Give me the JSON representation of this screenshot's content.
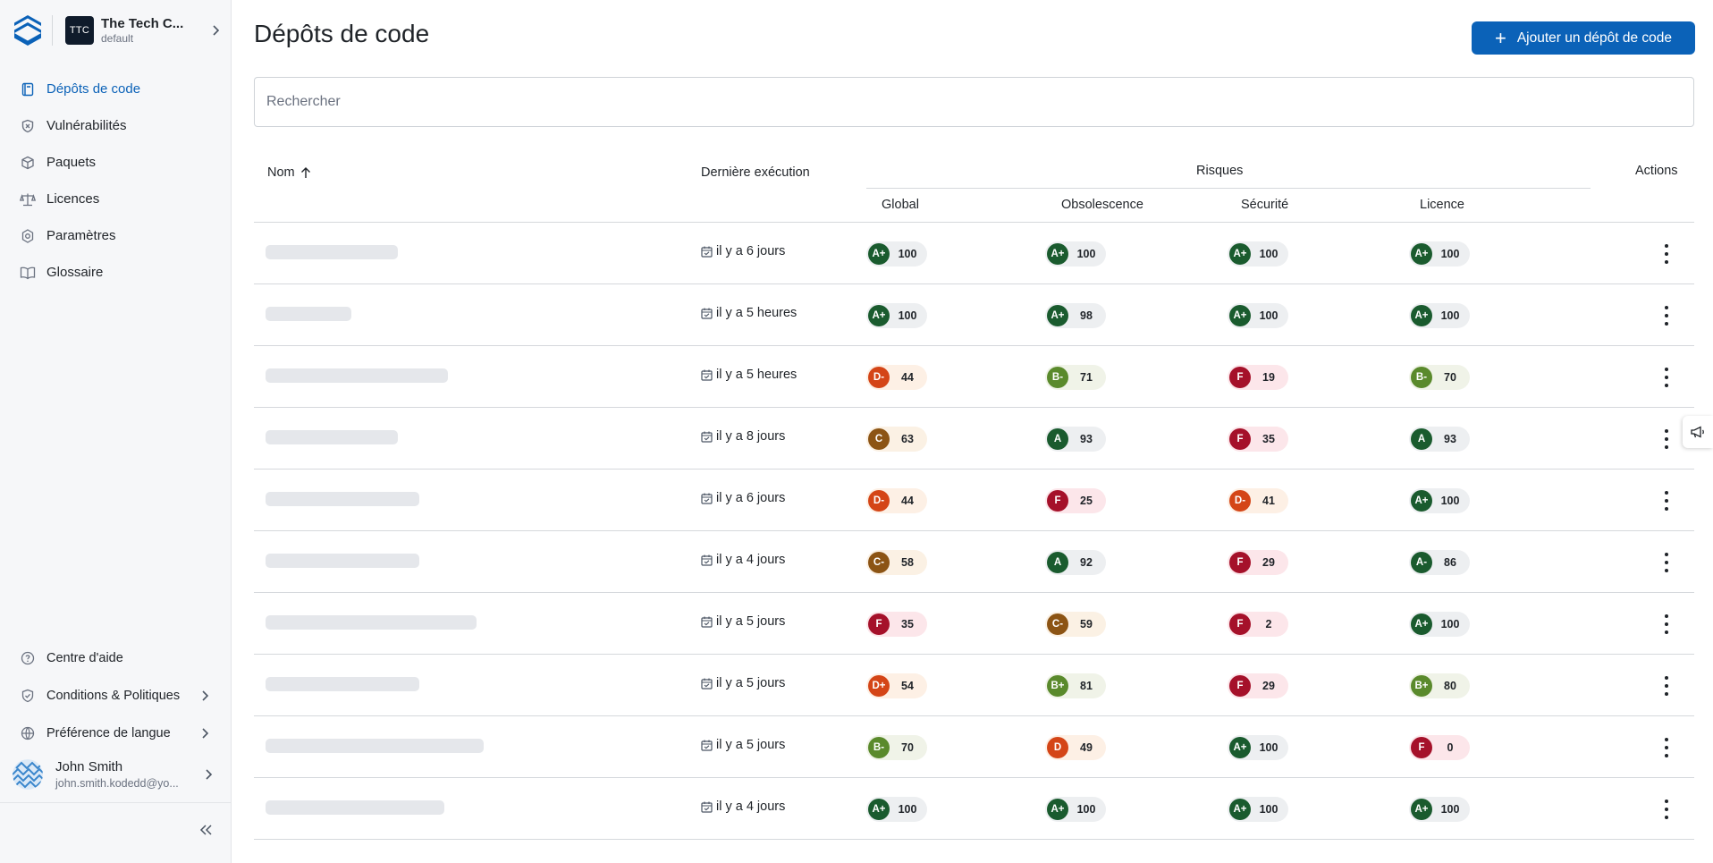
{
  "org": {
    "badge": "TTC",
    "name": "The Tech C...",
    "sub": "default"
  },
  "nav": [
    {
      "label": "Dépôts de code",
      "icon": "book-icon",
      "active": true
    },
    {
      "label": "Vulnérabilités",
      "icon": "shield-x-icon"
    },
    {
      "label": "Paquets",
      "icon": "package-icon"
    },
    {
      "label": "Licences",
      "icon": "scale-icon"
    },
    {
      "label": "Paramètres",
      "icon": "gear-icon"
    },
    {
      "label": "Glossaire",
      "icon": "open-book-icon"
    }
  ],
  "bottom_nav": [
    {
      "label": "Centre d'aide",
      "icon": "help-icon"
    },
    {
      "label": "Conditions & Politiques",
      "icon": "shield-check-icon"
    },
    {
      "label": "Préférence de langue",
      "icon": "globe-icon"
    }
  ],
  "user": {
    "name": "John Smith",
    "email": "john.smith.kodedd@yo..."
  },
  "page": {
    "title": "Dépôts de code",
    "add_button": "Ajouter un dépôt de code",
    "search_placeholder": "Rechercher"
  },
  "table": {
    "headers": {
      "name": "Nom",
      "last_run": "Dernière exécution",
      "risks": "Risques",
      "actions": "Actions",
      "global": "Global",
      "obsolescence": "Obsolescence",
      "security": "Sécurité",
      "license": "Licence"
    },
    "rows": [
      {
        "skeleton": 0.37,
        "date": "il y a 6 jours",
        "scores": [
          [
            "A+",
            "100"
          ],
          [
            "A+",
            "100"
          ],
          [
            "A+",
            "100"
          ],
          [
            "A+",
            "100"
          ]
        ]
      },
      {
        "skeleton": 0.24,
        "date": "il y a 5 heures",
        "scores": [
          [
            "A+",
            "100"
          ],
          [
            "A+",
            "98"
          ],
          [
            "A+",
            "100"
          ],
          [
            "A+",
            "100"
          ]
        ]
      },
      {
        "skeleton": 0.51,
        "date": "il y a 5 heures",
        "scores": [
          [
            "D-",
            "44"
          ],
          [
            "B-",
            "71"
          ],
          [
            "F",
            "19"
          ],
          [
            "B-",
            "70"
          ]
        ]
      },
      {
        "skeleton": 0.37,
        "date": "il y a 8 jours",
        "scores": [
          [
            "C",
            "63"
          ],
          [
            "A",
            "93"
          ],
          [
            "F",
            "35"
          ],
          [
            "A",
            "93"
          ]
        ]
      },
      {
        "skeleton": 0.43,
        "date": "il y a 6 jours",
        "scores": [
          [
            "D-",
            "44"
          ],
          [
            "F",
            "25"
          ],
          [
            "D-",
            "41"
          ],
          [
            "A+",
            "100"
          ]
        ]
      },
      {
        "skeleton": 0.43,
        "date": "il y a 4 jours",
        "scores": [
          [
            "C-",
            "58"
          ],
          [
            "A",
            "92"
          ],
          [
            "F",
            "29"
          ],
          [
            "A-",
            "86"
          ]
        ]
      },
      {
        "skeleton": 0.59,
        "date": "il y a 5 jours",
        "scores": [
          [
            "F",
            "35"
          ],
          [
            "C-",
            "59"
          ],
          [
            "F",
            "2"
          ],
          [
            "A+",
            "100"
          ]
        ]
      },
      {
        "skeleton": 0.43,
        "date": "il y a 5 jours",
        "scores": [
          [
            "D+",
            "54"
          ],
          [
            "B+",
            "81"
          ],
          [
            "F",
            "29"
          ],
          [
            "B+",
            "80"
          ]
        ]
      },
      {
        "skeleton": 0.61,
        "date": "il y a 5 jours",
        "scores": [
          [
            "B-",
            "70"
          ],
          [
            "D",
            "49"
          ],
          [
            "A+",
            "100"
          ],
          [
            "F",
            "0"
          ]
        ]
      },
      {
        "skeleton": 0.5,
        "date": "il y a 4 jours",
        "scores": [
          [
            "A+",
            "100"
          ],
          [
            "A+",
            "100"
          ],
          [
            "A+",
            "100"
          ],
          [
            "A+",
            "100"
          ]
        ]
      }
    ]
  }
}
